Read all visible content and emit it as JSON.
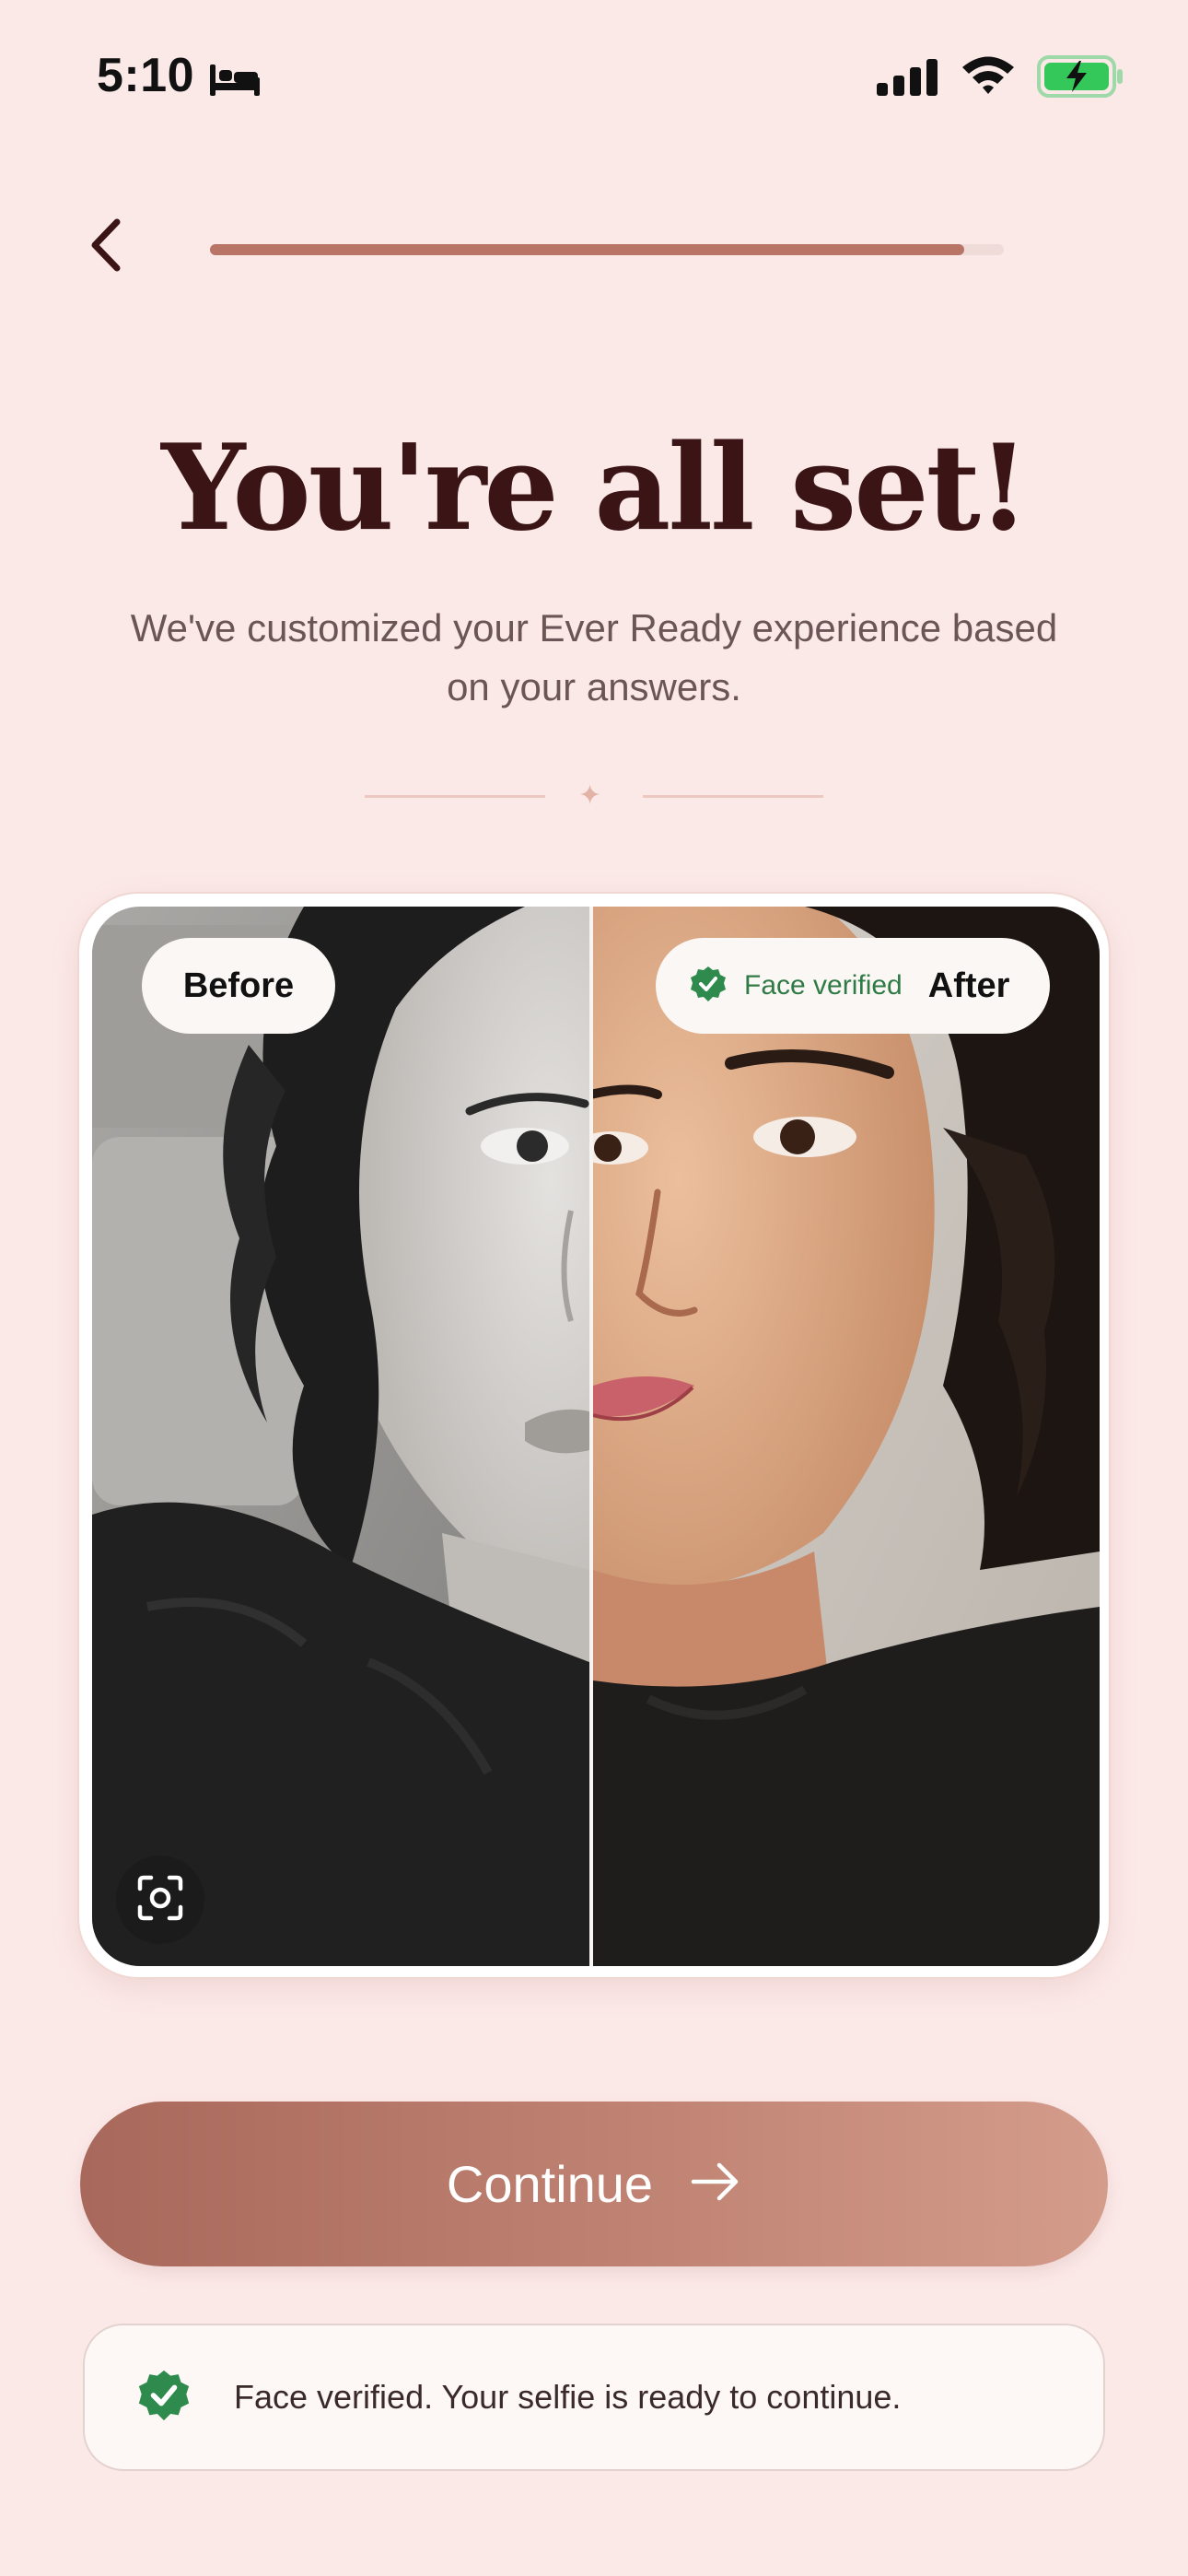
{
  "status_bar": {
    "time": "5:10",
    "icons": [
      "bed-icon",
      "signal-icon",
      "wifi-icon",
      "battery-charging-icon"
    ],
    "battery_color": "#34c759"
  },
  "nav": {
    "back_icon": "chevron-left-icon",
    "progress": 0.95,
    "progress_color": "#b87566"
  },
  "header": {
    "title": "You're all set!",
    "subtitle": "We've customized your Ever Ready experience based on your answers."
  },
  "comparison": {
    "before_label": "Before",
    "after_label": "After",
    "verified_badge": "Face verified",
    "scan_icon": "face-scan-icon"
  },
  "actions": {
    "continue_label": "Continue",
    "continue_icon": "arrow-right-icon"
  },
  "toast": {
    "message": "Face verified. Your selfie is ready to continue.",
    "icon": "verified-badge-icon",
    "icon_color": "#2f8a4e"
  },
  "colors": {
    "background": "#fbe9e8",
    "title": "#3b1416",
    "accent": "#b87566"
  }
}
